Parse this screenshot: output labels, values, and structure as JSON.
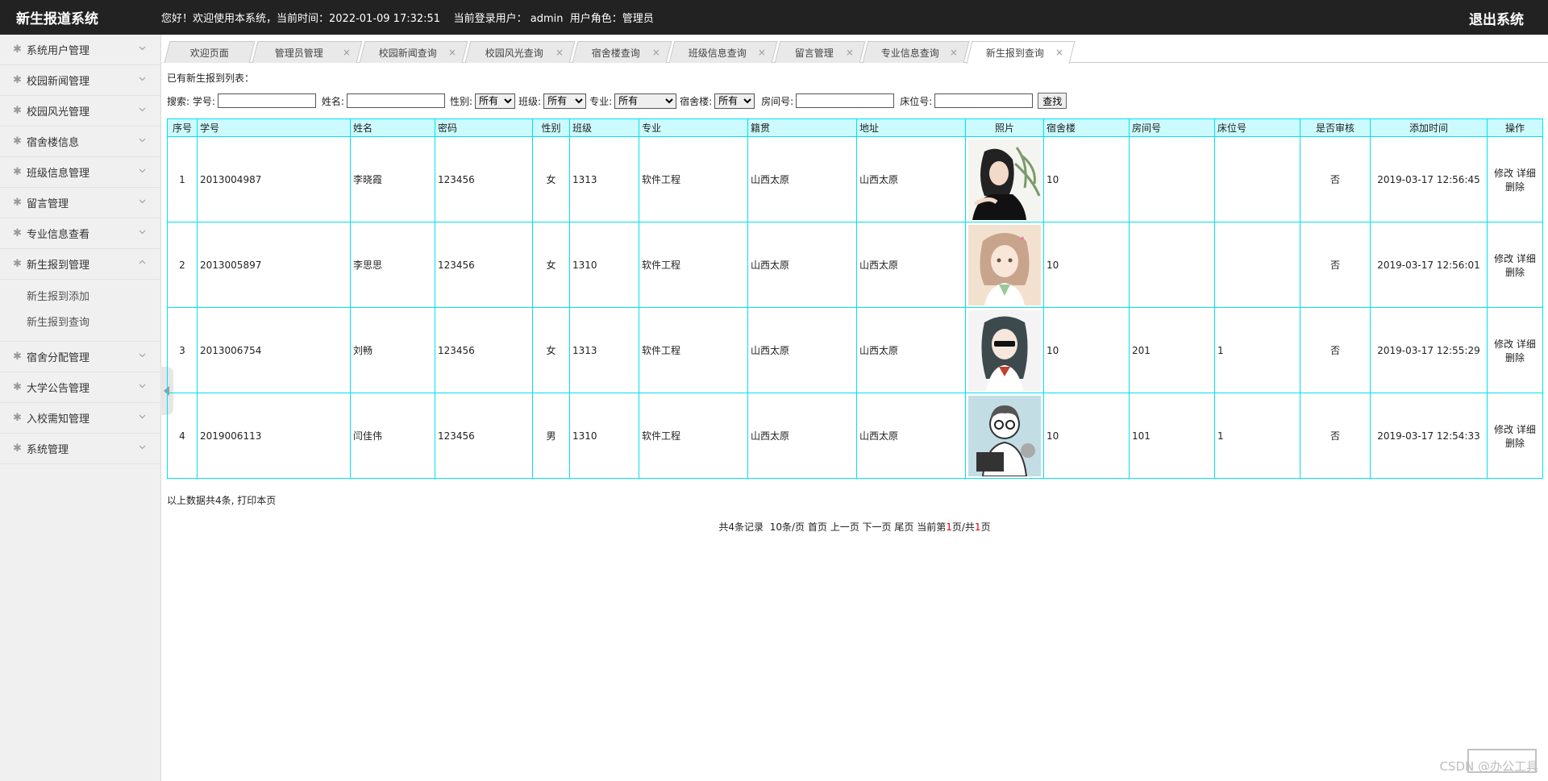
{
  "header": {
    "app_title": "新生报道系统",
    "welcome": "您好！欢迎使用本系统，当前时间：2022-01-09 17:32:51    当前登录用户： admin  用户角色：管理员",
    "logout": "退出系统"
  },
  "sidebar": {
    "items": [
      {
        "label": "系统用户管理"
      },
      {
        "label": "校园新闻管理"
      },
      {
        "label": "校园风光管理"
      },
      {
        "label": "宿舍楼信息"
      },
      {
        "label": "班级信息管理"
      },
      {
        "label": "留言管理"
      },
      {
        "label": "专业信息查看"
      },
      {
        "label": "新生报到管理"
      },
      {
        "label": "宿舍分配管理"
      },
      {
        "label": "大学公告管理"
      },
      {
        "label": "入校需知管理"
      },
      {
        "label": "系统管理"
      }
    ],
    "submenu": [
      "新生报到添加",
      "新生报到查询"
    ]
  },
  "tabs": [
    "欢迎页面",
    "管理员管理",
    "校园新闻查询",
    "校园风光查询",
    "宿舍楼查询",
    "班级信息查询",
    "留言管理",
    "专业信息查询",
    "新生报到查询"
  ],
  "main": {
    "caption": "已有新生报到列表：",
    "search": {
      "label": "搜索:",
      "xuehao": "学号:",
      "xingming": "姓名:",
      "xingbie": "性别:",
      "banji": "班级:",
      "zhuanye": "专业:",
      "sushelou": "宿舍楼:",
      "fangjianhao": "房间号:",
      "chuangweihao": "床位号:",
      "all_option": "所有",
      "button": "查找"
    },
    "columns": [
      "序号",
      "学号",
      "姓名",
      "密码",
      "性别",
      "班级",
      "专业",
      "籍贯",
      "地址",
      "照片",
      "宿舍楼",
      "房间号",
      "床位号",
      "是否审核",
      "添加时间",
      "操作"
    ],
    "rows": [
      {
        "no": "1",
        "xuehao": "2013004987",
        "xingming": "李晓霞",
        "mima": "123456",
        "xingbie": "女",
        "banji": "1313",
        "zhuanye": "软件工程",
        "jiguan": "山西太原",
        "dizhi": "山西太原",
        "sushelou": "10",
        "fangjianhao": "",
        "chuangweihao": "",
        "shenhe": "否",
        "time": "2019-03-17 12:56:45"
      },
      {
        "no": "2",
        "xuehao": "2013005897",
        "xingming": "李思思",
        "mima": "123456",
        "xingbie": "女",
        "banji": "1310",
        "zhuanye": "软件工程",
        "jiguan": "山西太原",
        "dizhi": "山西太原",
        "sushelou": "10",
        "fangjianhao": "",
        "chuangweihao": "",
        "shenhe": "否",
        "time": "2019-03-17 12:56:01"
      },
      {
        "no": "3",
        "xuehao": "2013006754",
        "xingming": "刘畅",
        "mima": "123456",
        "xingbie": "女",
        "banji": "1313",
        "zhuanye": "软件工程",
        "jiguan": "山西太原",
        "dizhi": "山西太原",
        "sushelou": "10",
        "fangjianhao": "201",
        "chuangweihao": "1",
        "shenhe": "否",
        "time": "2019-03-17 12:55:29"
      },
      {
        "no": "4",
        "xuehao": "2019006113",
        "xingming": "闫佳伟",
        "mima": "123456",
        "xingbie": "男",
        "banji": "1310",
        "zhuanye": "软件工程",
        "jiguan": "山西太原",
        "dizhi": "山西太原",
        "sushelou": "10",
        "fangjianhao": "101",
        "chuangweihao": "1",
        "shenhe": "否",
        "time": "2019-03-17 12:54:33"
      }
    ],
    "ops": {
      "edit": "修改",
      "detail": "详细",
      "delete": "删除"
    },
    "footnote": "以上数据共4条, 打印本页",
    "pager": {
      "total": "共4条记录",
      "per_page": "10条/页",
      "first": "首页",
      "prev": "上一页",
      "next": "下一页",
      "last": "尾页",
      "current_prefix": "当前第",
      "current": "1",
      "current_mid": "页/共",
      "total_pages": "1",
      "current_suffix": "页"
    }
  },
  "watermark": "CSDN @办公工具"
}
